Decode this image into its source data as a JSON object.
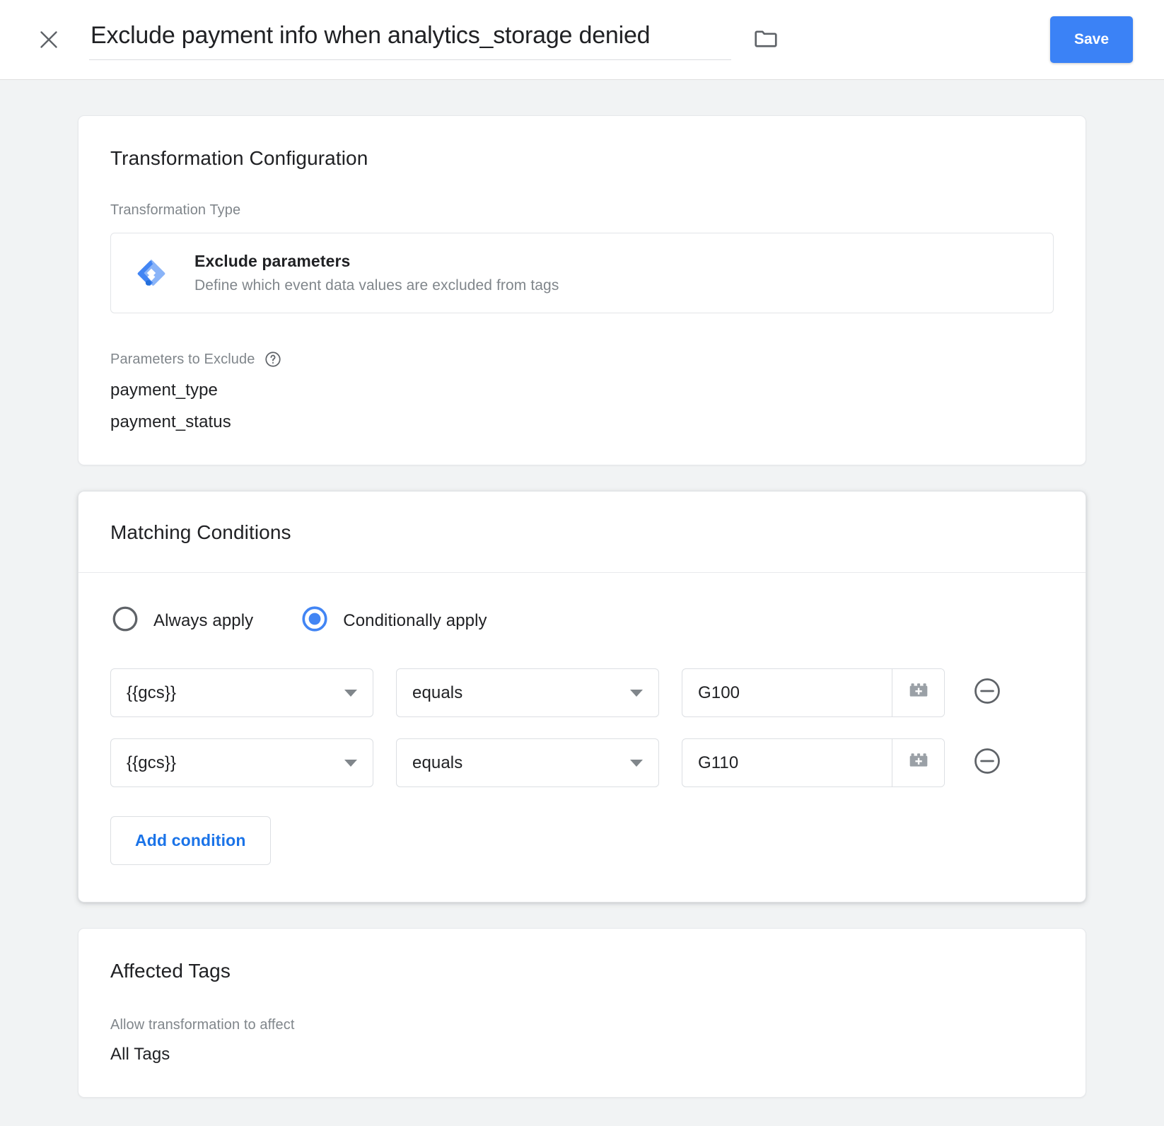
{
  "header": {
    "close_icon": "close-icon",
    "title_value": "Exclude payment info when analytics_storage denied",
    "title_placeholder": "Untitled Transformation",
    "folder_icon": "folder-icon",
    "save_label": "Save",
    "accent_color": "#3b82f6"
  },
  "transformation_card": {
    "title": "Transformation Configuration",
    "type_label": "Transformation Type",
    "type": {
      "icon": "gtm-diamond-icon",
      "name": "Exclude parameters",
      "description": "Define which event data values are excluded from tags"
    },
    "params_label": "Parameters to Exclude",
    "help_icon": "help-circle-icon",
    "parameters": [
      "payment_type",
      "payment_status"
    ]
  },
  "matching_conditions": {
    "title": "Matching Conditions",
    "radios": [
      {
        "label": "Always apply",
        "selected": false
      },
      {
        "label": "Conditionally apply",
        "selected": true
      }
    ],
    "selected_color": "#4285f4",
    "conditions": [
      {
        "variable": "{{gcs}}",
        "operator": "equals",
        "value": "G100",
        "value_placeholder": "",
        "brick_icon": "lego-brick-plus-icon",
        "remove_icon": "remove-circle-icon"
      },
      {
        "variable": "{{gcs}}",
        "operator": "equals",
        "value": "G110",
        "value_placeholder": "",
        "brick_icon": "lego-brick-plus-icon",
        "remove_icon": "remove-circle-icon"
      }
    ],
    "add_condition_label": "Add condition",
    "link_color": "#1a73e8"
  },
  "affected_tags": {
    "title": "Affected Tags",
    "label": "Allow transformation to affect",
    "value": "All Tags"
  }
}
